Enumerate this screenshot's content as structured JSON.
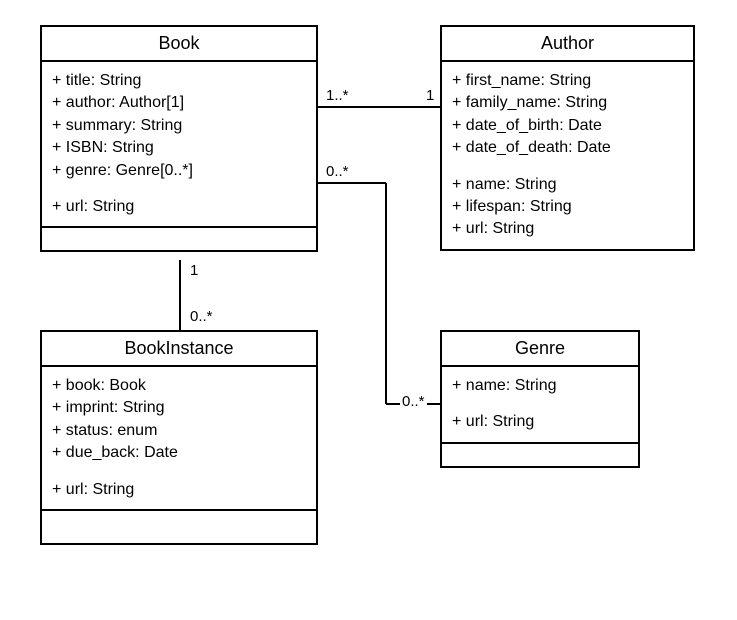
{
  "diagram_type": "UML Class Diagram",
  "classes": {
    "book": {
      "name": "Book",
      "attrs": [
        "+ title: String",
        "+ author: Author[1]",
        "+ summary: String",
        "+ ISBN: String",
        "+ genre: Genre[0..*]"
      ],
      "extra": [
        "+ url: String"
      ]
    },
    "author": {
      "name": "Author",
      "attrs": [
        "+ first_name: String",
        "+ family_name: String",
        "+ date_of_birth: Date",
        "+ date_of_death: Date"
      ],
      "extra": [
        "+ name: String",
        "+ lifespan: String",
        "+ url: String"
      ]
    },
    "bookinstance": {
      "name": "BookInstance",
      "attrs": [
        "+ book: Book",
        "+ imprint: String",
        "+ status: enum",
        "+ due_back: Date"
      ],
      "extra": [
        "+ url: String"
      ]
    },
    "genre": {
      "name": "Genre",
      "attrs": [
        "+ name: String"
      ],
      "extra": [
        "+ url: String"
      ]
    }
  },
  "relations": {
    "book_author": {
      "near_book": "1..*",
      "near_author": "1"
    },
    "book_genre": {
      "near_book": "0..*",
      "near_genre": "0..*"
    },
    "book_instance": {
      "near_book": "1",
      "near_instance": "0..*"
    }
  }
}
